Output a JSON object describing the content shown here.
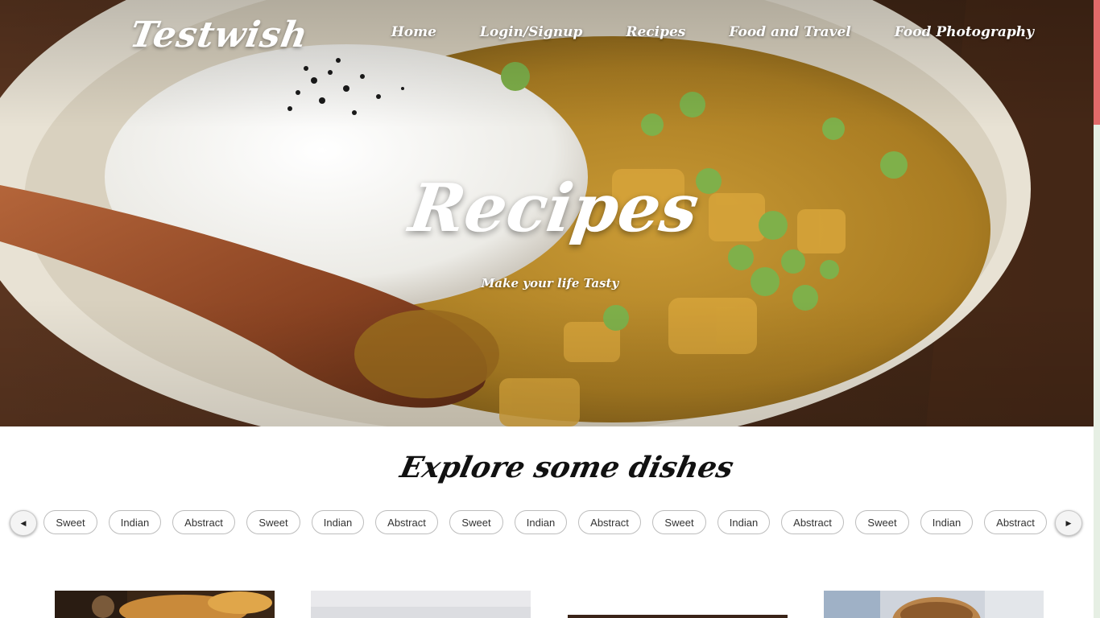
{
  "brand": "Testwish",
  "nav": {
    "items": [
      "Home",
      "Login/Signup",
      "Recipes",
      "Food and Travel",
      "Food Photography"
    ]
  },
  "hero": {
    "title": "Recipes",
    "subtitle": "Make your life Tasty"
  },
  "explore": {
    "title": "Explore some dishes",
    "chips": [
      "Sweet",
      "Indian",
      "Abstract",
      "Sweet",
      "Indian",
      "Abstract",
      "Sweet",
      "Indian",
      "Abstract",
      "Sweet",
      "Indian",
      "Abstract",
      "Sweet",
      "Indian",
      "Abstract"
    ]
  },
  "icons": {
    "prev": "chevron-left-icon",
    "next": "chevron-right-icon"
  },
  "colors": {
    "scroll_thumb": "#e26a6a",
    "chip_border": "#bdbdbd",
    "text_dark": "#111111"
  }
}
